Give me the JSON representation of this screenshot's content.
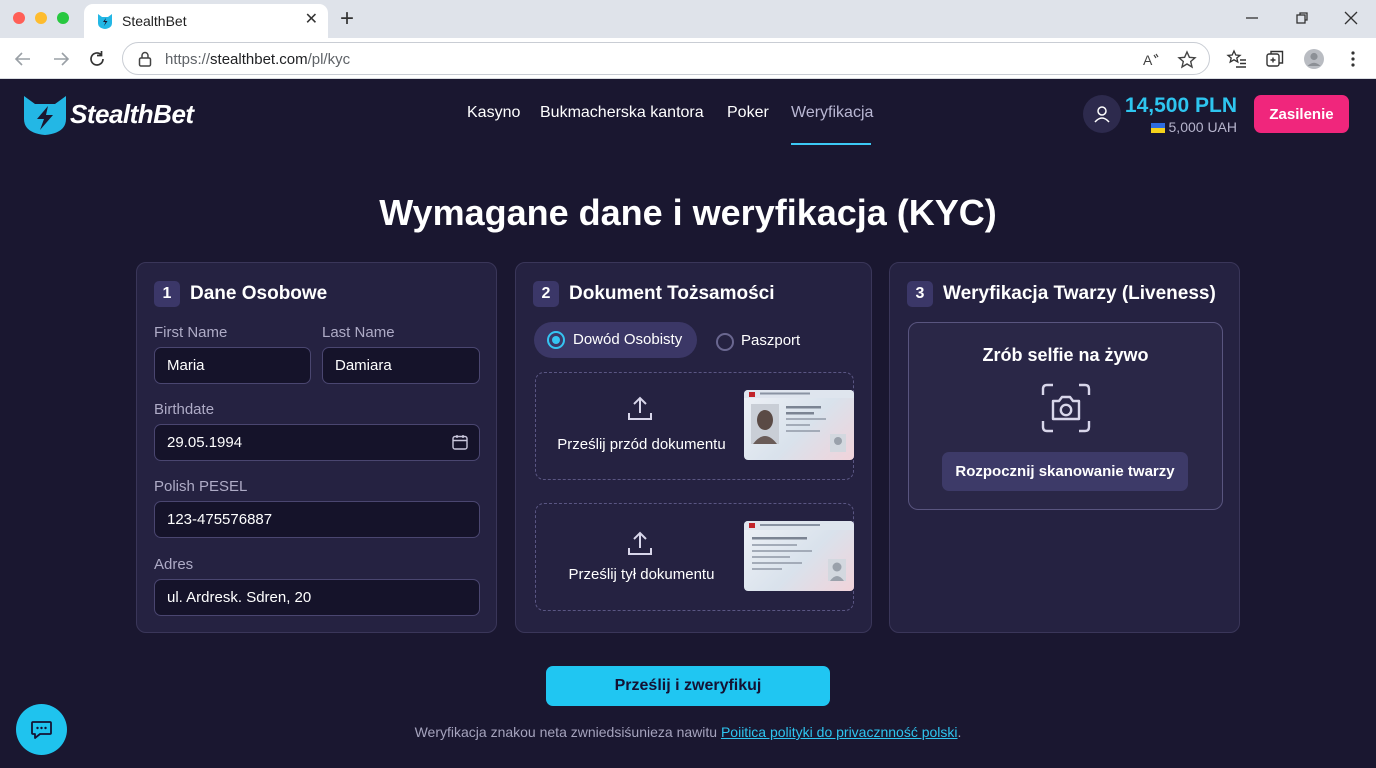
{
  "browser": {
    "tab_title": "StealthBet",
    "url_prefix": "https://",
    "url_host": "stealthbet.com",
    "url_path": "/pl/kyc"
  },
  "site": {
    "name": "StealthBet",
    "nav": [
      "Kasyno",
      "Bukmacherska kantora",
      "Poker",
      "Weryfikacja"
    ],
    "active_nav": "Weryfikacja",
    "balance": "14,500 PLN",
    "balance_secondary": "5,000 UAH",
    "deposit_label": "Zasilenie",
    "accent_color": "#20c6f2",
    "deposit_color": "#f0267c"
  },
  "page": {
    "title": "Wymagane dane i weryfikacja (KYC)"
  },
  "personal": {
    "step": "1",
    "title": "Dane Osobowe",
    "first_name_label": "First Name",
    "first_name_value": "Maria",
    "last_name_label": "Last Name",
    "last_name_value": "Damiara",
    "birthdate_label": "Birthdate",
    "birthdate_value": "29.05.1994",
    "pesel_label": "Polish PESEL",
    "pesel_value": "123-475576887",
    "address_label": "Adres",
    "address_value": "ul. Ardresk. Sdren, 20"
  },
  "document": {
    "step": "2",
    "title": "Dokument Tożsamości",
    "option_id": "Dowód Osobisty",
    "option_passport": "Paszport",
    "selected_option": "Dowód Osobisty",
    "upload_front": "Prześlij przód dokumentu",
    "upload_back": "Prześlij tył dokumentu"
  },
  "face": {
    "step": "3",
    "title": "Weryfikacja Twarzy (Liveness)",
    "prompt": "Zrób selfie na żywo",
    "scan_button": "Rozpocznij skanowanie twarzy"
  },
  "footer": {
    "submit_label": "Prześlij i zweryfikuj",
    "note_text": "Weryfikacja znakou neta zwniedsiśunieza nawitu ",
    "note_link": "Poiitica polityki do privacznność polski",
    "note_suffix": "."
  }
}
